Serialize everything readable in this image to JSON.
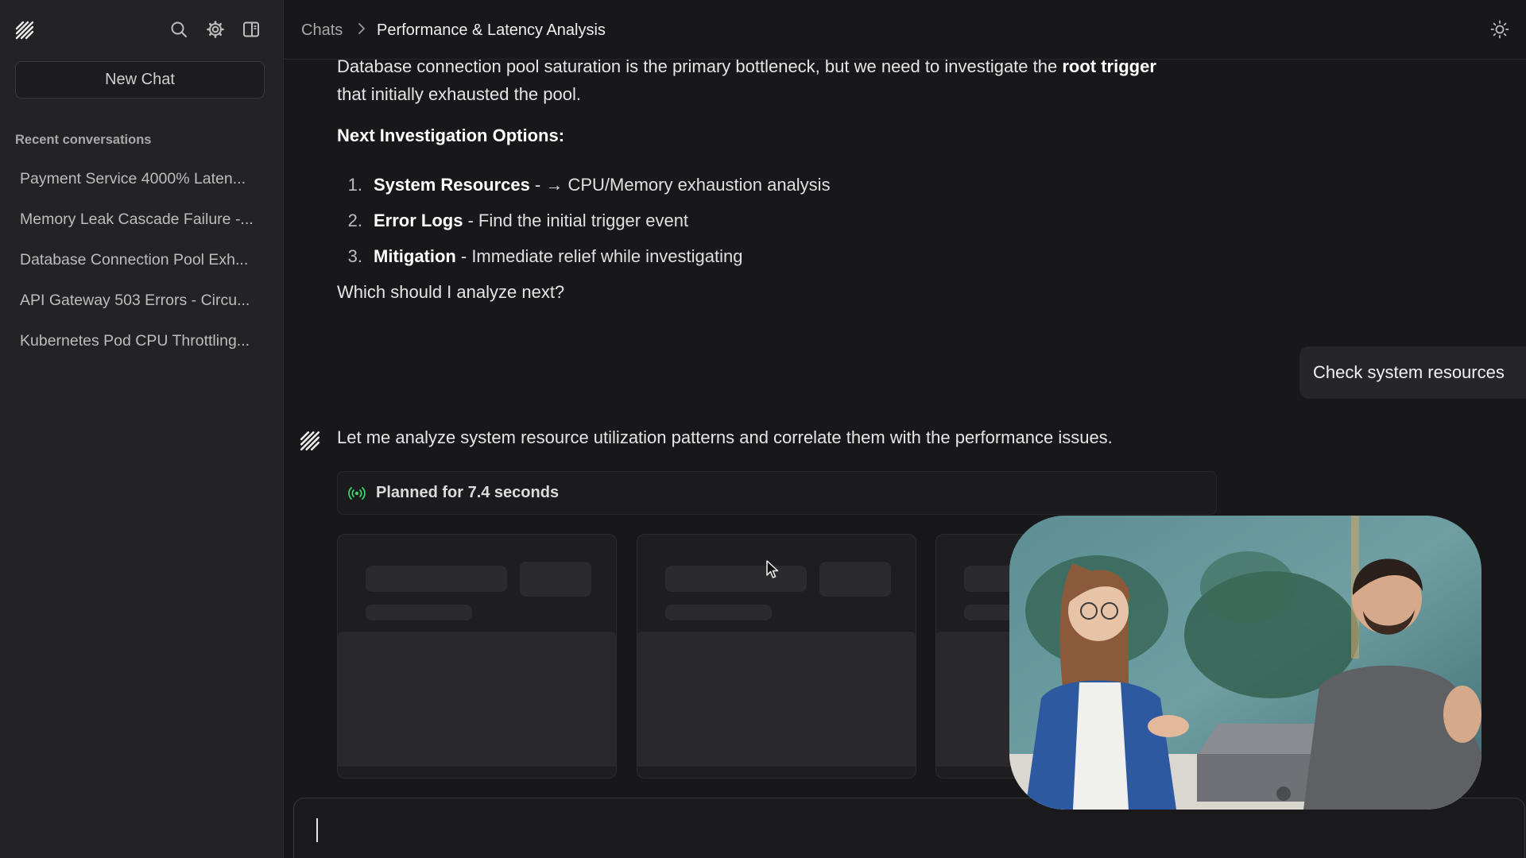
{
  "sidebar": {
    "new_chat_label": "New Chat",
    "recent_label": "Recent conversations",
    "conversations": [
      "Payment Service 4000% Laten...",
      "Memory Leak Cascade Failure -...",
      "Database Connection Pool Exh...",
      "API Gateway 503 Errors - Circu...",
      "Kubernetes Pod CPU Throttling..."
    ],
    "icons": [
      "logo-icon",
      "search-icon",
      "gear-icon",
      "sidebar-toggle-icon"
    ]
  },
  "header": {
    "breadcrumb_root": "Chats",
    "breadcrumb_current": "Performance & Latency Analysis",
    "theme_icon": "sun-icon"
  },
  "assistant_message_1": {
    "line1_pre": "Database connection pool saturation is the primary bottleneck, but we need to investigate the ",
    "line1_bold": "root trigger",
    "line2": "that initially exhausted the pool.",
    "heading": "Next Investigation Options:",
    "options": [
      {
        "num": "1.",
        "title": "System Resources",
        "desc": "- → CPU/Memory exhaustion analysis"
      },
      {
        "num": "2.",
        "title": "Error Logs",
        "desc": "- Find the initial trigger event"
      },
      {
        "num": "3.",
        "title": "Mitigation",
        "desc": "- Immediate relief while investigating"
      }
    ],
    "question": "Which should I analyze next?"
  },
  "user_message": "Check system resources",
  "assistant_message_2": {
    "text": "Let me analyze system resource utilization patterns and correlate them with the performance issues.",
    "planned_label": "Planned for 7.4 seconds"
  },
  "colors": {
    "background": "#18181a",
    "sidebar": "#232325",
    "accent_green": "#3ecf6e"
  }
}
